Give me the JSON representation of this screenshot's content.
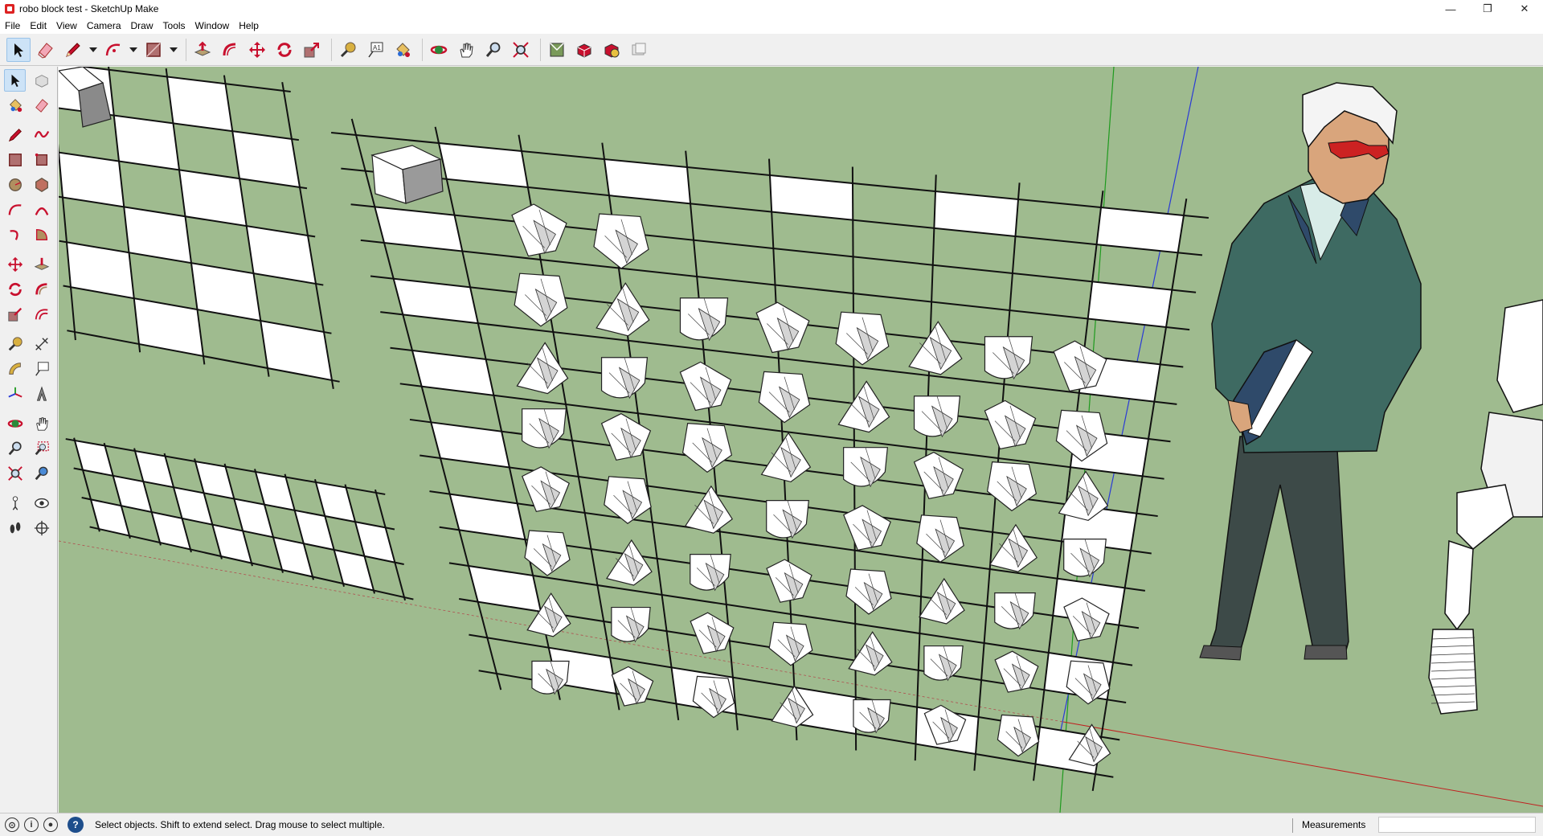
{
  "window": {
    "title": "robo block test - SketchUp Make",
    "minimize": "—",
    "restore": "❐",
    "close": "✕"
  },
  "menu": [
    "File",
    "Edit",
    "View",
    "Camera",
    "Draw",
    "Tools",
    "Window",
    "Help"
  ],
  "top_toolbar": [
    "select-icon",
    "eraser-icon",
    "pencil-line-icon",
    "arc-icon",
    "rectangle-icon",
    "push-pull-icon",
    "follow-me-icon",
    "move-icon",
    "rotate-icon",
    "scale-icon",
    "tape-measure-icon",
    "text-icon",
    "paint-bucket-icon",
    "orbit-icon",
    "pan-icon",
    "zoom-icon",
    "zoom-extents-icon",
    "3d-warehouse-icon",
    "components-icon",
    "extension-warehouse-icon",
    "layout-icon"
  ],
  "left_toolbar": [
    [
      "select-icon",
      "component-icon"
    ],
    [
      "paint-bucket-icon",
      "eraser-icon"
    ],
    [
      "line-icon",
      "freehand-icon"
    ],
    [
      "rectangle-icon",
      "rotated-rectangle-icon"
    ],
    [
      "circle-icon",
      "polygon-icon"
    ],
    [
      "arc-icon",
      "two-point-arc-icon"
    ],
    [
      "three-point-arc-icon",
      "pie-icon"
    ],
    [
      "move-icon",
      "push-pull-icon"
    ],
    [
      "rotate-icon",
      "follow-me-icon"
    ],
    [
      "scale-icon",
      "offset-icon"
    ],
    [
      "tape-measure-icon",
      "dimension-icon"
    ],
    [
      "protractor-icon",
      "text-icon"
    ],
    [
      "axes-icon",
      "3d-text-icon"
    ],
    [
      "orbit-icon",
      "pan-icon"
    ],
    [
      "zoom-icon",
      "zoom-window-icon"
    ],
    [
      "zoom-extents-icon",
      "previous-view-icon"
    ],
    [
      "position-camera-icon",
      "look-around-icon"
    ],
    [
      "walk-icon",
      "section-plane-icon"
    ]
  ],
  "status": {
    "hint": "Select objects. Shift to extend select. Drag mouse to select multiple.",
    "measurements_label": "Measurements",
    "measurements_value": ""
  },
  "colors": {
    "viewport_bg": "#9fbb8f",
    "grid_line": "#111111",
    "white_cell": "#ffffff",
    "active_tool": "#cde3f7",
    "green_axis": "#1e9a1e",
    "blue_axis": "#2a3ad6",
    "red_axis": "#c02020"
  }
}
